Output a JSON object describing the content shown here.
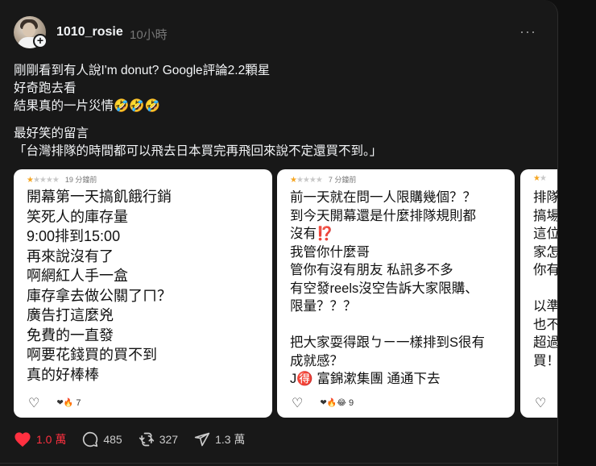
{
  "post": {
    "username": "1010_rosie",
    "timestamp": "10小時",
    "more_label": "···",
    "lines": [
      "剛剛看到有人說I'm donut? Google評論2.2顆星",
      "好奇跑去看",
      "結果真的一片災情🤣🤣🤣",
      "",
      "最好笑的留言",
      "「台灣排隊的時間都可以飛去日本買完再飛回來說不定還買不到。」"
    ]
  },
  "screenshots": [
    {
      "ago": "19 分鐘前",
      "stars": 1,
      "text": "開幕第一天搞飢餓行銷\n笑死人的庫存量\n9:00排到15:00\n再來說沒有了\n啊網紅人手一盒\n庫存拿去做公關了ㄇ？\n廣告打這麼兇\n免費的一直發\n啊要花錢買的買不到\n真的好棒棒",
      "reactions": "❤🔥",
      "count": "7"
    },
    {
      "ago": "7 分鐘前",
      "stars": 1,
      "text": "前一天就在問一人限購幾個？？\n到今天開幕還是什麼排隊規則都\n沒有⁉️\n我管你什麼哥\n管你有沒有朋友 私訊多不多\n有空發reels沒空告訴大家限購、\n限量？？？\n\n把大家耍得跟ㄅㄧ一樣排到S很有\n成就感？\nJ🉐 富錦漱集團 通通下去",
      "reactions": "❤🔥😂",
      "count": "9"
    },
    {
      "ago": "",
      "stars": 1,
      "text": "排隊\n搞場\n這位\n家怎\n你有\n\n以準\n也不\n超過\n買！",
      "reactions": "",
      "count": ""
    }
  ],
  "actions": {
    "likes": "1.0 萬",
    "comments": "485",
    "reposts": "327",
    "shares": "1.3 萬"
  },
  "colors": {
    "background": "#101010",
    "card": "#181818",
    "text": "#f3f5f7",
    "muted": "#777777",
    "like": "#ff3040",
    "star": "#f5a623"
  }
}
